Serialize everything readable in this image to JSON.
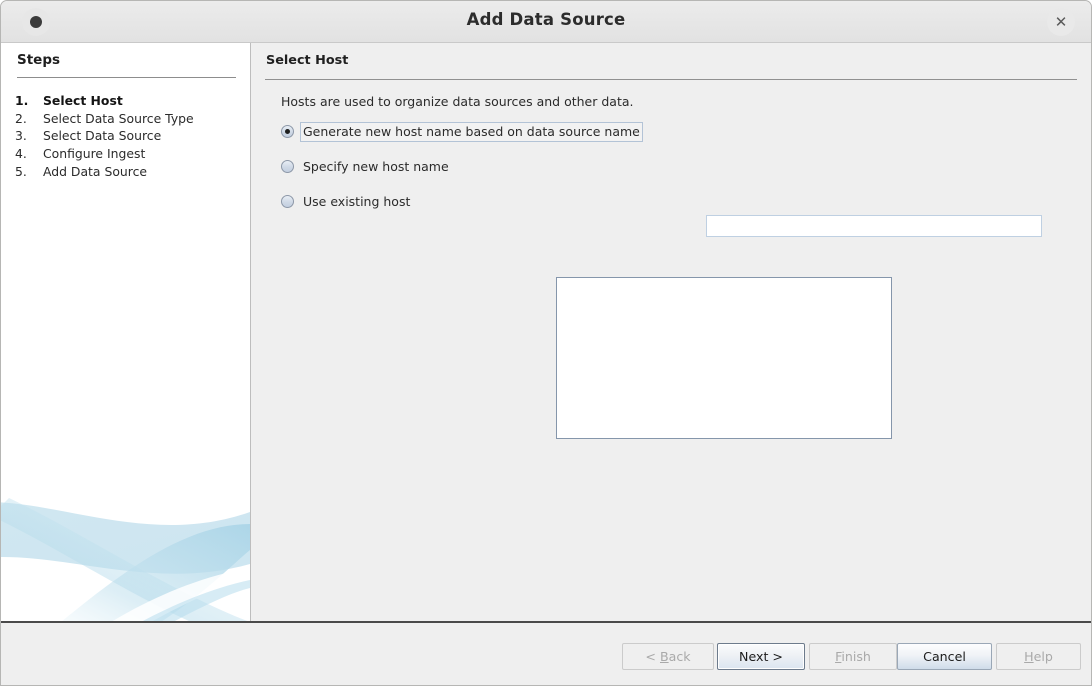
{
  "window": {
    "title": "Add Data Source",
    "menu_icon": "window-menu-dot-icon",
    "close_icon": "close-icon",
    "close_glyph": "✕"
  },
  "steps_pane": {
    "heading": "Steps",
    "items": [
      {
        "number": "1.",
        "label": "Select Host",
        "current": true
      },
      {
        "number": "2.",
        "label": "Select Data Source Type",
        "current": false
      },
      {
        "number": "3.",
        "label": "Select Data Source",
        "current": false
      },
      {
        "number": "4.",
        "label": "Configure Ingest",
        "current": false
      },
      {
        "number": "5.",
        "label": "Add Data Source",
        "current": false
      }
    ],
    "decoration": "wizard-watermark-swoosh"
  },
  "main": {
    "section_title": "Select Host",
    "description": "Hosts are used to organize data sources and other data.",
    "options": [
      {
        "id": "generate-host-name",
        "label": "Generate new host name based on data source name",
        "selected": true,
        "focused": true
      },
      {
        "id": "specify-host-name",
        "label": "Specify new host name",
        "selected": false,
        "focused": false
      },
      {
        "id": "use-existing-host",
        "label": "Use existing host",
        "selected": false,
        "focused": false
      }
    ],
    "hostname_field": {
      "value": "",
      "placeholder": ""
    },
    "existing_hosts": {
      "items": [],
      "selected": ""
    }
  },
  "buttons": {
    "back": {
      "label_pre": "< ",
      "mnemonic": "B",
      "label_post": "ack",
      "enabled": false,
      "focused": false
    },
    "next": {
      "label": "Next >",
      "enabled": true,
      "focused": true
    },
    "finish": {
      "label_pre": "",
      "mnemonic": "F",
      "label_post": "inish",
      "enabled": false,
      "focused": false
    },
    "cancel": {
      "label": "Cancel",
      "enabled": true,
      "focused": false
    },
    "help": {
      "label_pre": "",
      "mnemonic": "H",
      "label_post": "elp",
      "enabled": false,
      "focused": false
    }
  },
  "colors": {
    "dialog_bg": "#efefef",
    "steps_bg": "#ffffff",
    "titlebar_bg": "#e8e8e8",
    "accent_border": "#8596ab",
    "watermark": "#b8dbe8"
  }
}
